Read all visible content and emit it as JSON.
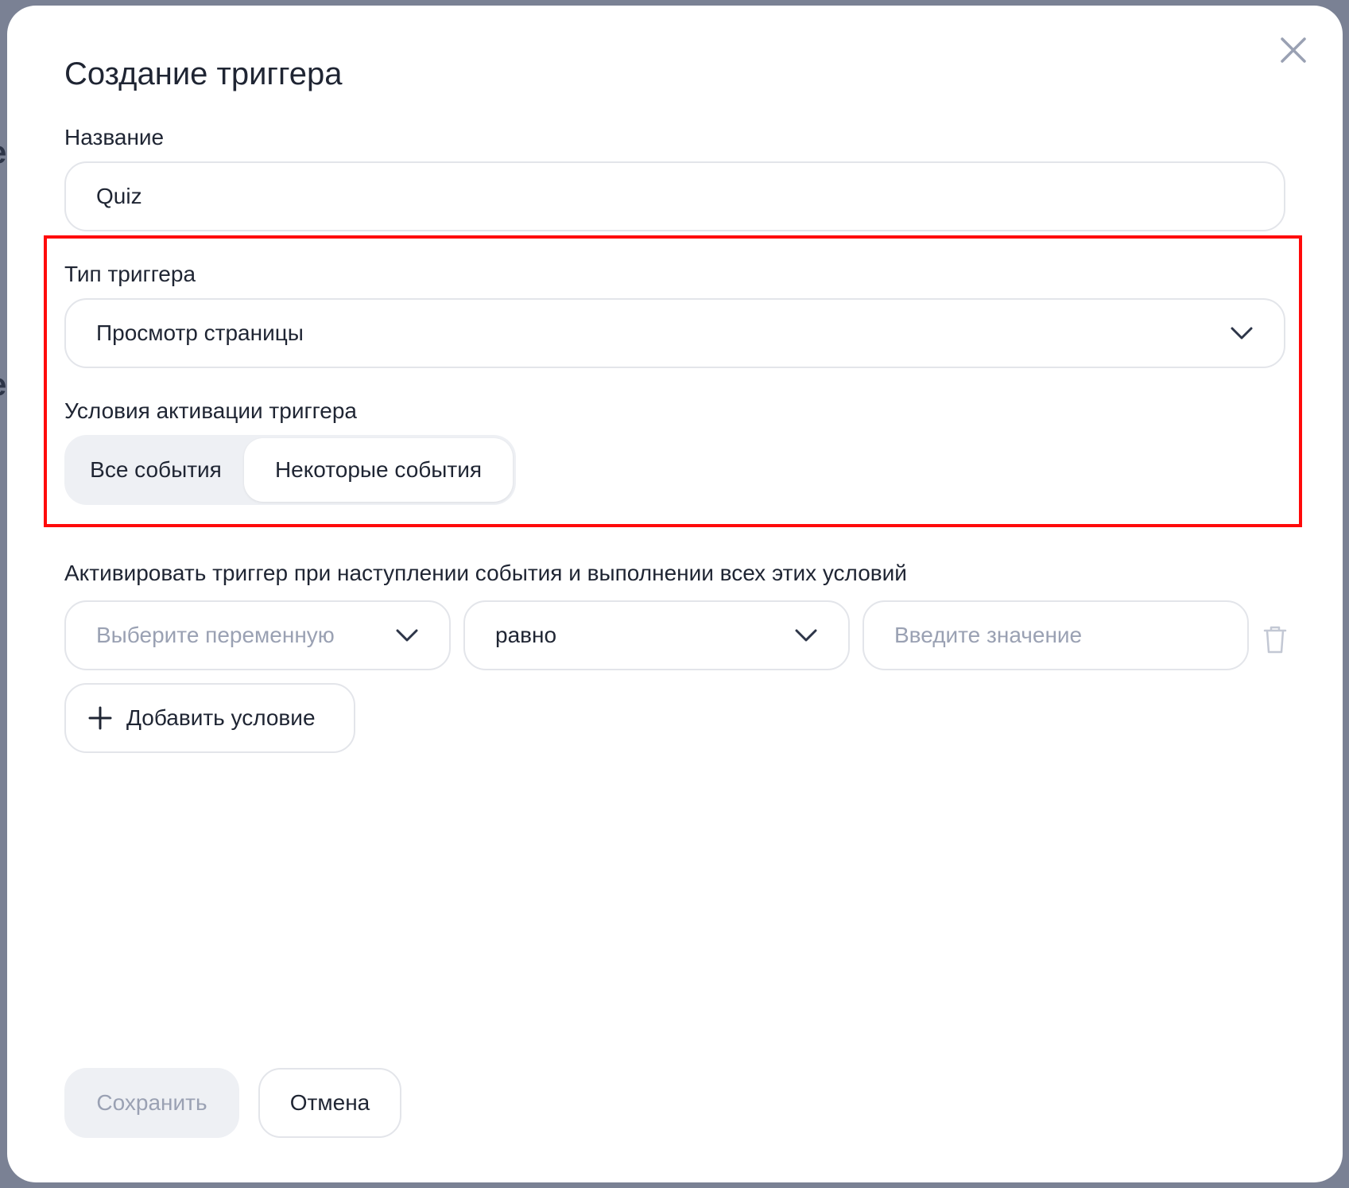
{
  "dialog": {
    "title": "Создание триггера"
  },
  "name_field": {
    "label": "Название",
    "value": "Quiz"
  },
  "trigger_type": {
    "label": "Тип триггера",
    "value": "Просмотр страницы"
  },
  "activation": {
    "label": "Условия активации триггера",
    "options": [
      "Все события",
      "Некоторые события"
    ],
    "selected": "Некоторые события"
  },
  "conditions": {
    "heading": "Активировать триггер при наступлении события и выполнении всех этих условий",
    "variable_placeholder": "Выберите переменную",
    "operator_value": "равно",
    "value_placeholder": "Введите значение",
    "add_label": "Добавить условие"
  },
  "footer": {
    "save_label": "Сохранить",
    "cancel_label": "Отмена"
  },
  "colors": {
    "highlight": "#ff0a0a",
    "text": "#1f2533",
    "muted": "#9aa1b3",
    "border": "#e3e5ea",
    "segment_bg": "#eef0f4"
  },
  "icons": [
    "close-icon",
    "chevron-down-icon",
    "trash-icon",
    "plus-icon"
  ]
}
